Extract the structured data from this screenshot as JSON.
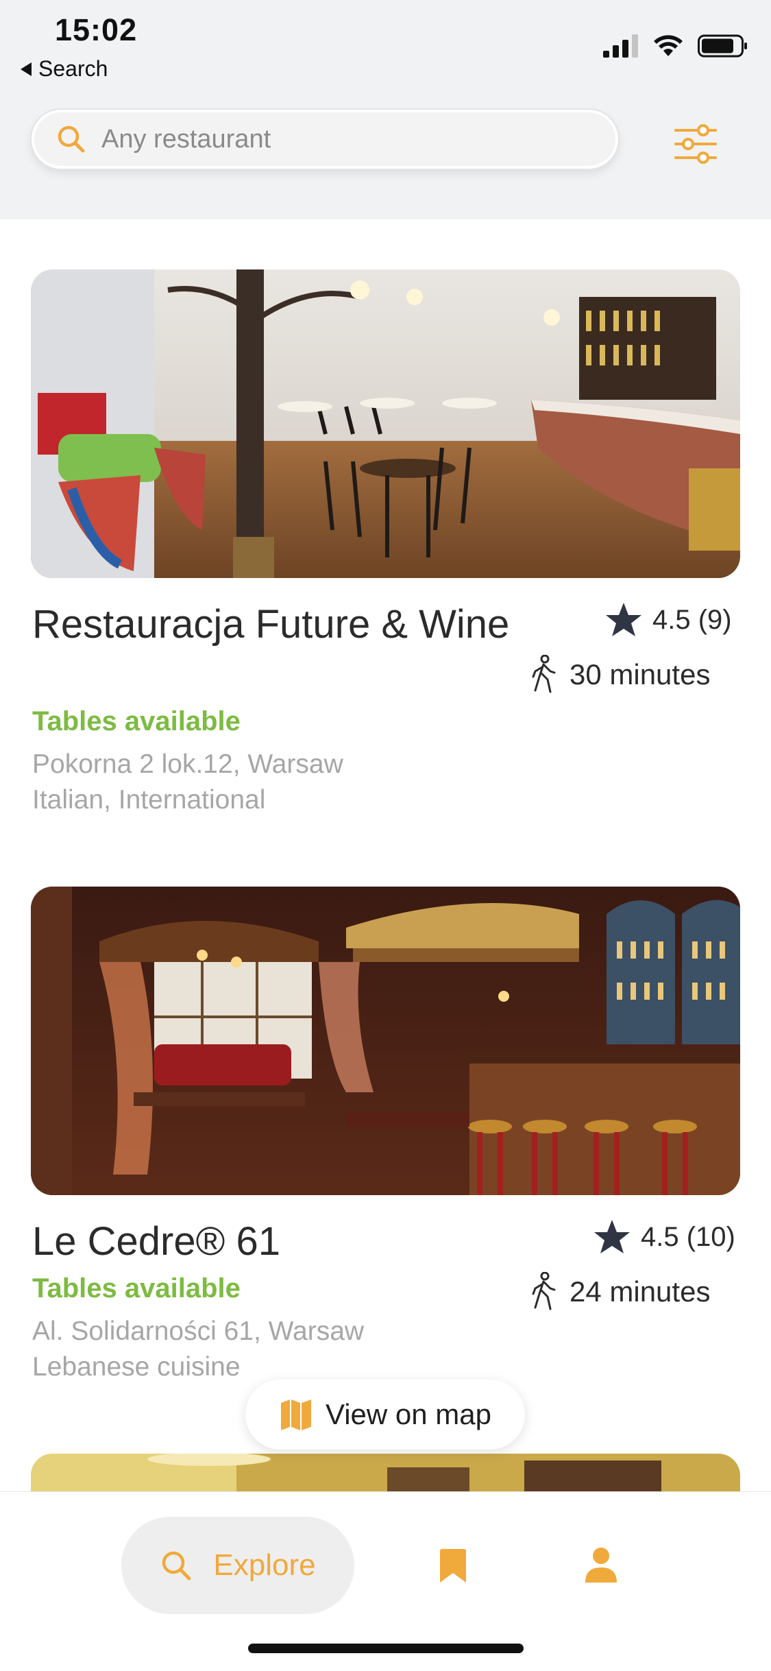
{
  "status_bar": {
    "time": "15:02",
    "back_label": "Search"
  },
  "search": {
    "placeholder": "Any restaurant"
  },
  "restaurants": [
    {
      "name": "Restauracja Future & Wine",
      "availability": "Tables available",
      "address": "Pokorna 2 lok.12, Warsaw",
      "cuisine": "Italian, International",
      "rating": "4.5 (9)",
      "walk_time": "30 minutes"
    },
    {
      "name": "Le Cedre® 61",
      "availability": "Tables available",
      "address": "Al. Solidarności 61, Warsaw",
      "cuisine": "Lebanese cuisine",
      "rating": "4.5 (10)",
      "walk_time": "24 minutes"
    }
  ],
  "map_button": {
    "label": "View on map"
  },
  "tabs": {
    "explore_label": "Explore"
  },
  "colors": {
    "accent": "#f0a93b",
    "available": "#7dbb42",
    "header_bg": "#f1f2f4"
  },
  "icons": [
    "search-icon",
    "filter-icon",
    "star-icon",
    "walking-icon",
    "map-icon",
    "bookmark-icon",
    "profile-icon",
    "signal-icon",
    "wifi-icon",
    "battery-icon"
  ]
}
